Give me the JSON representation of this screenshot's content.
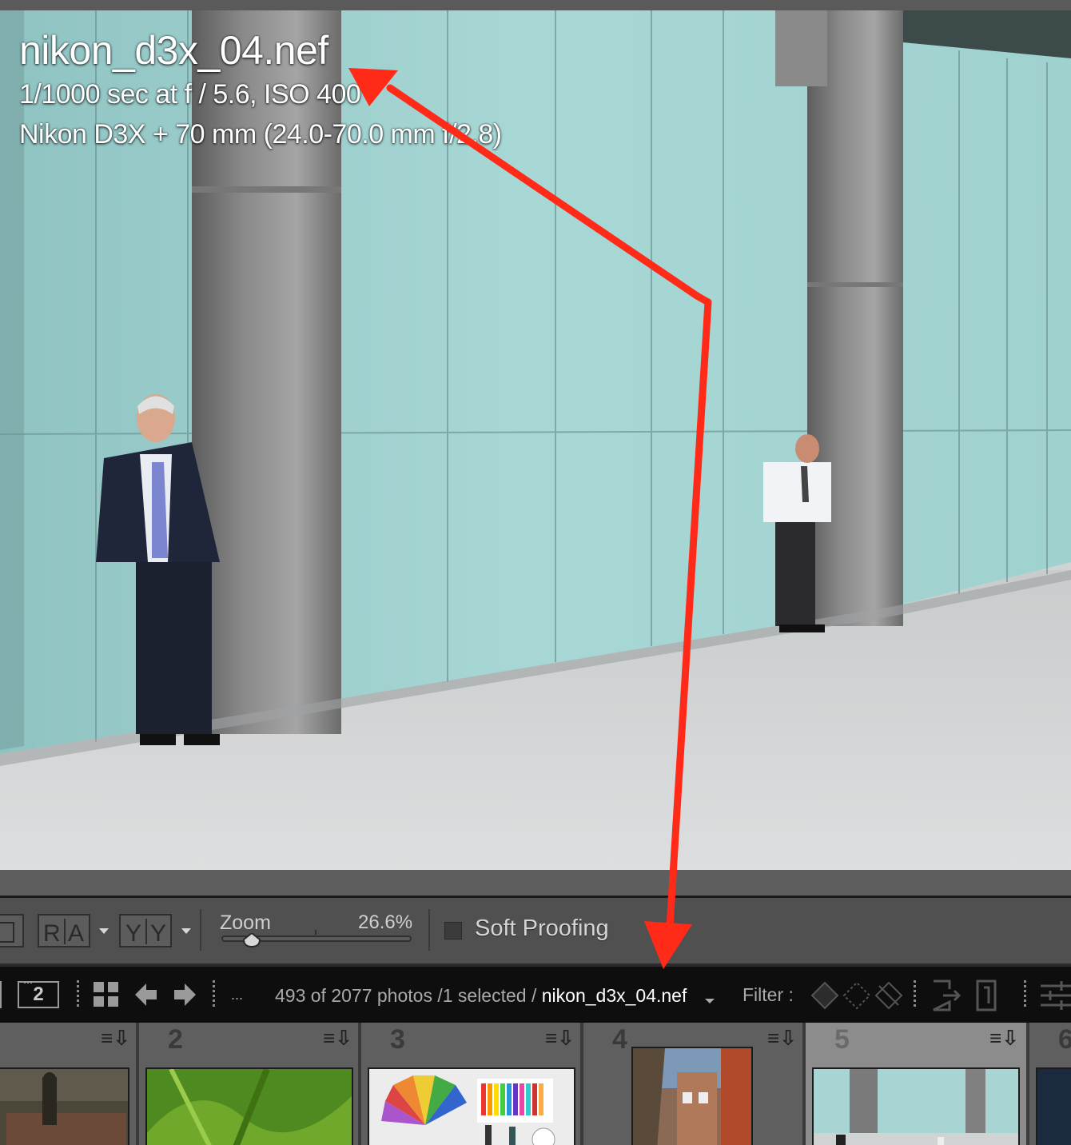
{
  "photo_info": {
    "filename": "nikon_d3x_04.nef",
    "exposure": "1/1000 sec at f / 5.6, ISO 400",
    "camera": "Nikon D3X + 70 mm (24.0-70.0 mm f/2.8)"
  },
  "toolbar": {
    "view_buttons": [
      "R",
      "A",
      "Y",
      "Y"
    ],
    "zoom_label": "Zoom",
    "zoom_value": "26.6%",
    "zoom_fraction": 0.15,
    "soft_proofing_label": "Soft Proofing",
    "soft_proofing_checked": false
  },
  "filmstrip_header": {
    "secondary_window": "2",
    "counts": "493 of 2077 photos /1 selected /",
    "current_file": "nikon_d3x_04.nef",
    "more": "...",
    "filter_label": "Filter :"
  },
  "filmstrip": {
    "cells": [
      {
        "number": ""
      },
      {
        "number": "2"
      },
      {
        "number": "3"
      },
      {
        "number": "4"
      },
      {
        "number": "5",
        "selected": true
      },
      {
        "number": "6"
      }
    ]
  },
  "annotation": {
    "arrow_color": "#ff2a17"
  }
}
